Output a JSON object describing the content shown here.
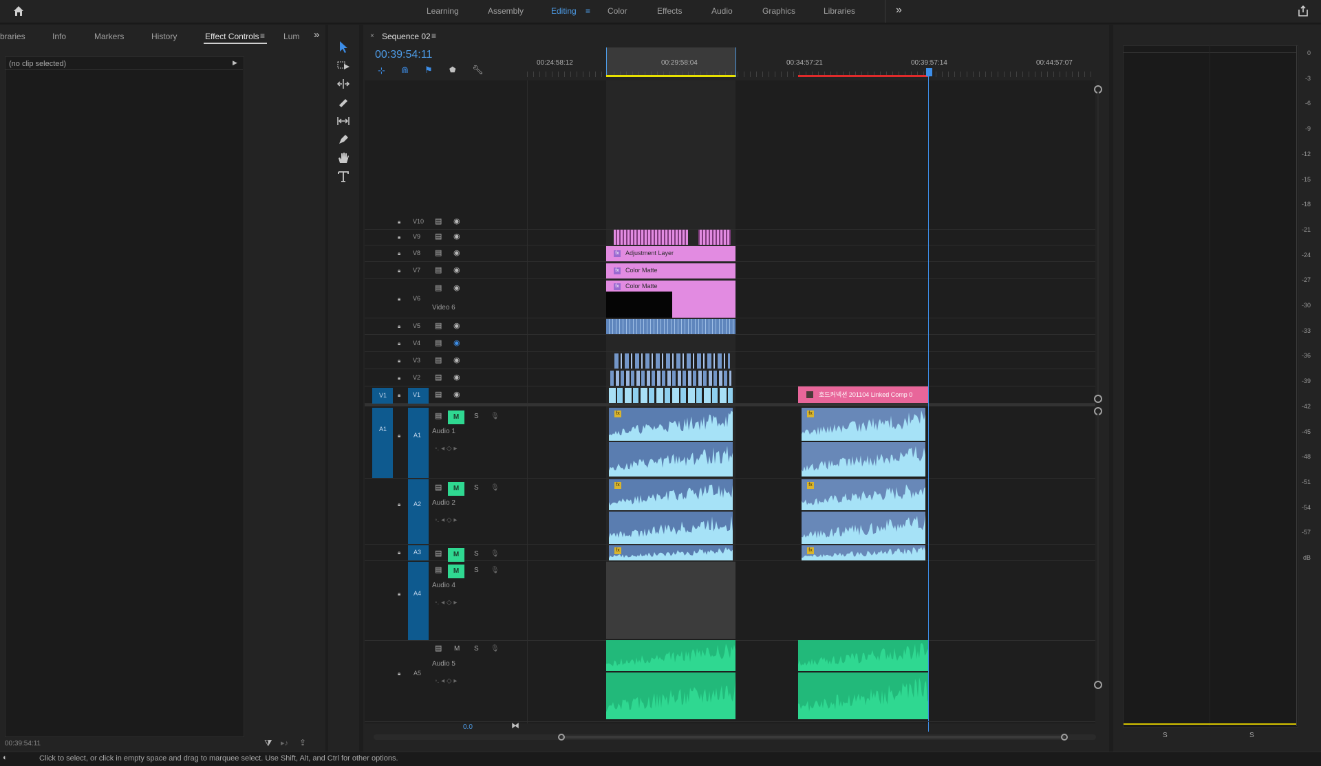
{
  "topbar": {
    "workspaces": [
      "Learning",
      "Assembly",
      "Editing",
      "Color",
      "Effects",
      "Audio",
      "Graphics",
      "Libraries"
    ],
    "active": "Editing",
    "more": "»"
  },
  "left_panel": {
    "tabs": [
      "braries",
      "Info",
      "Markers",
      "History",
      "Effect Controls",
      "Lum"
    ],
    "active": "Effect Controls",
    "no_clip": "(no clip selected)",
    "timecode": "00:39:54:11"
  },
  "sequence": {
    "name": "Sequence 02",
    "timecode": "00:39:54:11",
    "ruler": [
      "00:24:58:12",
      "00:29:58:04",
      "00:34:57:21",
      "00:39:57:14",
      "00:44:57:07"
    ],
    "bottom_value": "0.0"
  },
  "video_tracks": [
    {
      "id": "V10",
      "label": ""
    },
    {
      "id": "V9",
      "label": ""
    },
    {
      "id": "V8",
      "label": ""
    },
    {
      "id": "V7",
      "label": ""
    },
    {
      "id": "V6",
      "label": "Video 6"
    },
    {
      "id": "V5",
      "label": ""
    },
    {
      "id": "V4",
      "label": ""
    },
    {
      "id": "V3",
      "label": ""
    },
    {
      "id": "V2",
      "label": ""
    },
    {
      "id": "V1",
      "label": ""
    }
  ],
  "audio_tracks": [
    {
      "id": "A1",
      "label": "Audio 1",
      "source": "A1"
    },
    {
      "id": "A2",
      "label": "Audio 2",
      "source": ""
    },
    {
      "id": "A3",
      "label": "",
      "source": ""
    },
    {
      "id": "A4",
      "label": "Audio 4",
      "source": ""
    },
    {
      "id": "A5",
      "label": "Audio 5",
      "source": ""
    }
  ],
  "source_v": "V1",
  "clips": {
    "adjustment": "Adjustment Layer",
    "matte1": "Color Matte",
    "matte2": "Color Matte",
    "linked": "호드커넥션 201104  Linked Comp 0"
  },
  "mute_label": "M",
  "solo_label": "S",
  "meter": {
    "scale": [
      "0",
      "-3",
      "-6",
      "-9",
      "-12",
      "-15",
      "-18",
      "-21",
      "-24",
      "-27",
      "-30",
      "-33",
      "-36",
      "-39",
      "-42",
      "-45",
      "-48",
      "-51",
      "-54",
      "-57",
      "dB"
    ],
    "solo": [
      "S",
      "S"
    ]
  },
  "status": "Click to select, or click in empty space and drag to marquee select. Use Shift, Alt, and Ctrl for other options.",
  "colors": {
    "accent": "#4d9be6",
    "pink": "#e28be1",
    "hotpink": "#e8669a",
    "audio_blue": "#6e8fbf",
    "green": "#2fd891"
  }
}
